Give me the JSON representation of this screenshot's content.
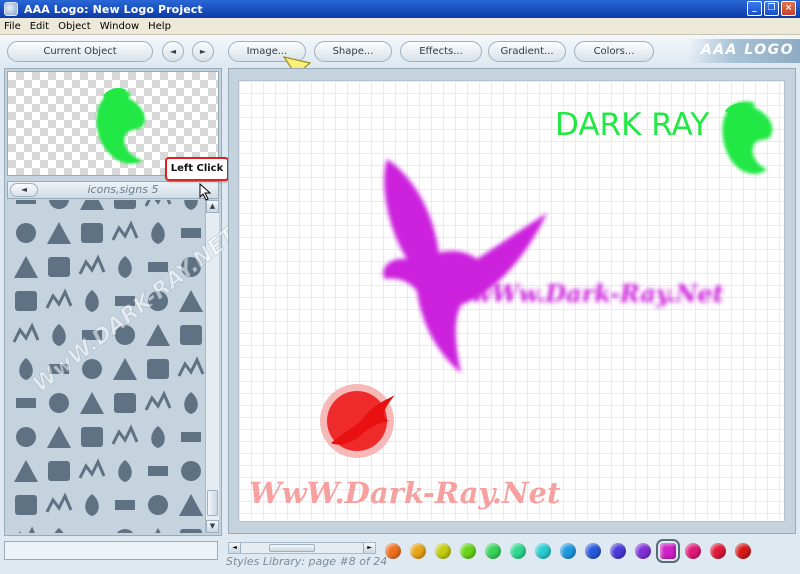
{
  "window": {
    "title": "AAA Logo: New Logo Project"
  },
  "menu": [
    "File",
    "Edit",
    "Object",
    "Window",
    "Help"
  ],
  "toolbar": {
    "current_object": "Current Object",
    "prev": "◄",
    "next": "►",
    "image": "Image...",
    "shape": "Shape...",
    "effects": "Effects...",
    "gradient": "Gradient...",
    "colors": "Colors...",
    "brand": "AAA LOGO"
  },
  "library": {
    "prev": "◄",
    "title": "icons,signs 5"
  },
  "tooltip": {
    "left_click": "Left Click"
  },
  "canvas": {
    "logo_text": "DARK RAY",
    "url_purple": "wWw.Dark-Ray.Net",
    "url_pink": "WwW.Dark-Ray.Net"
  },
  "watermark": "WwW.DARK-RAY.NET",
  "styles": {
    "label": "Styles Library: page #8 of 24"
  },
  "swatches": [
    "#f07020",
    "#e8a418",
    "#c4cc10",
    "#66d418",
    "#36d458",
    "#2ed890",
    "#28cdd0",
    "#1e98e0",
    "#2858e0",
    "#4a3ad8",
    "#8030d8",
    "#d020c8",
    "#e01878",
    "#e01838",
    "#d81818"
  ],
  "colors": {
    "accent_green": "#22e844",
    "accent_purple": "#cc22dd",
    "accent_red": "#e81010",
    "accent_pink": "#f7a0a0"
  }
}
